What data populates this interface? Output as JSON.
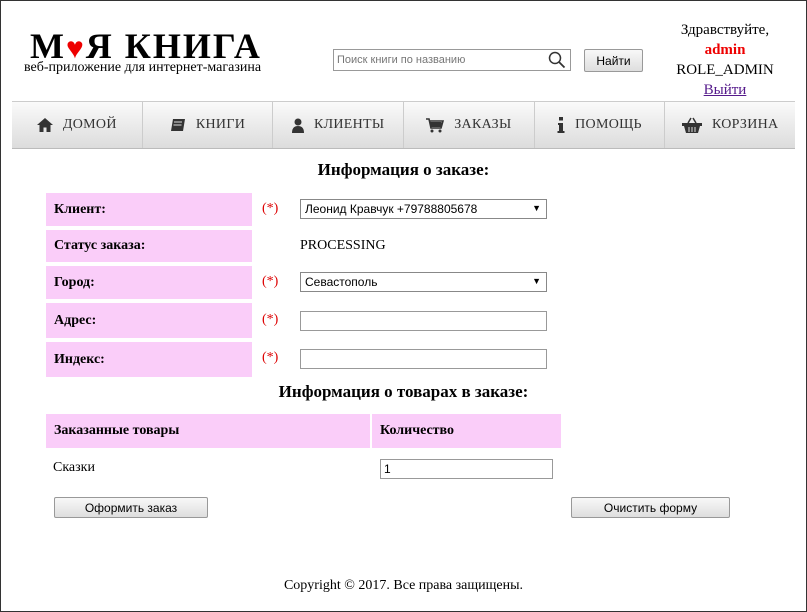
{
  "header": {
    "logo_left": "М",
    "logo_heart": "♥",
    "logo_right": "Я КНИГА",
    "tagline": "веб-приложение для интернет-магазина",
    "search_placeholder": "Поиск книги по названию",
    "find_button": "Найти",
    "greeting": "Здравствуйте,",
    "username": "admin",
    "role": "ROLE_ADMIN",
    "logout": "Выйти"
  },
  "nav": [
    {
      "label": "ДОМОЙ",
      "icon": "home-icon"
    },
    {
      "label": "КНИГИ",
      "icon": "book-icon"
    },
    {
      "label": "КЛИЕНТЫ",
      "icon": "user-icon"
    },
    {
      "label": "ЗАКАЗЫ",
      "icon": "cart-icon"
    },
    {
      "label": "ПОМОЩЬ",
      "icon": "info-icon"
    },
    {
      "label": "КОРЗИНА",
      "icon": "basket-icon"
    }
  ],
  "order": {
    "title": "Информация о заказе:",
    "required_mark": "(*)",
    "client_label": "Клиент:",
    "client_value": "Леонид Кравчук +79788805678",
    "status_label": "Статус заказа:",
    "status_value": "PROCESSING",
    "city_label": "Город:",
    "city_value": "Севастополь",
    "address_label": "Адрес:",
    "address_value": "",
    "index_label": "Индекс:",
    "index_value": ""
  },
  "items": {
    "title": "Информация о товарах в заказе:",
    "col_products": "Заказанные товары",
    "col_quantity": "Количество",
    "rows": [
      {
        "product": "Сказки",
        "quantity": "1"
      }
    ]
  },
  "buttons": {
    "submit": "Оформить заказ",
    "clear": "Очистить форму"
  },
  "footer": "Copyright © 2017. Все права защищены.",
  "colors": {
    "label_bg": "#facdf9",
    "required": "#dd0000",
    "username": "#ee0000"
  }
}
